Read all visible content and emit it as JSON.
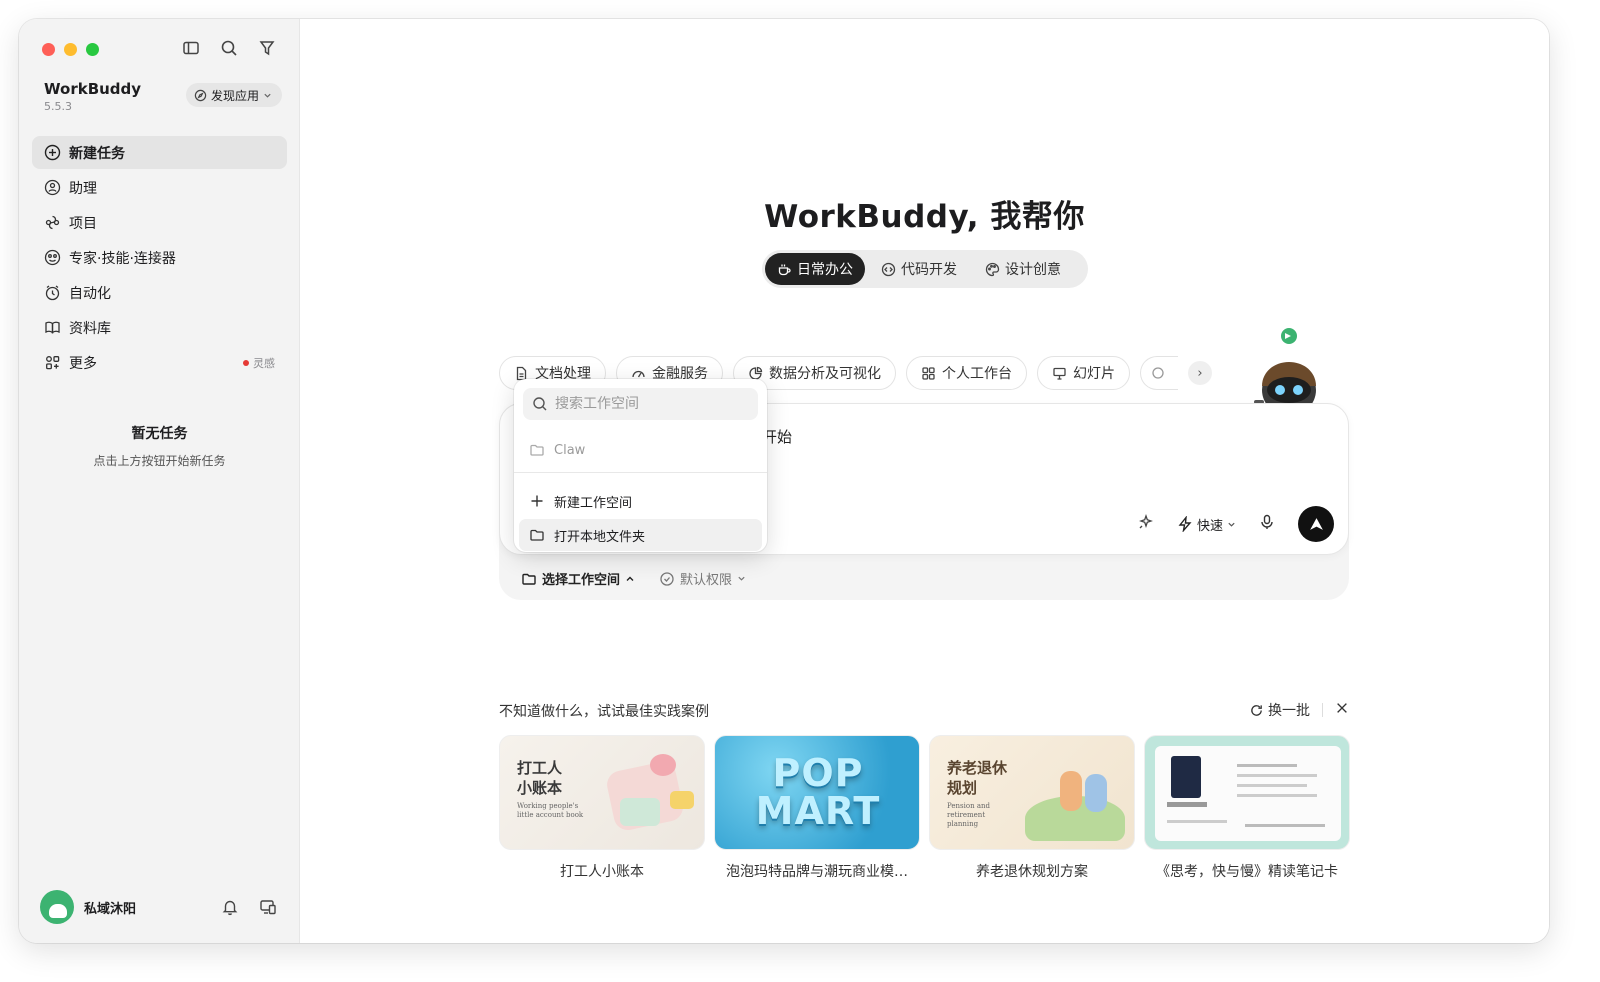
{
  "sidebar": {
    "app_name": "WorkBuddy",
    "version": "5.5.3",
    "discover_label": "发现应用",
    "items": [
      {
        "label": "新建任务",
        "icon": "plus-circle-icon"
      },
      {
        "label": "助理",
        "icon": "assistant-icon"
      },
      {
        "label": "项目",
        "icon": "project-icon"
      },
      {
        "label": "专家·技能·连接器",
        "icon": "expert-icon"
      },
      {
        "label": "自动化",
        "icon": "alarm-icon"
      },
      {
        "label": "资料库",
        "icon": "book-icon"
      },
      {
        "label": "更多",
        "icon": "grid-icon",
        "badge": "灵感"
      }
    ],
    "empty_title": "暂无任务",
    "empty_sub": "点击上方按钮开始新任务",
    "user_name": "私域沐阳"
  },
  "main": {
    "hero": "WorkBuddy, 我帮你",
    "tabs": [
      "日常办公",
      "代码开发",
      "设计创意"
    ],
    "chips": [
      "文档处理",
      "金融服务",
      "数据分析及可视化",
      "个人工作台",
      "幻灯片"
    ],
    "composer_text": "开始",
    "speed_label": "快速",
    "workspace_label": "选择工作空间",
    "permission_label": "默认权限",
    "dropdown": {
      "search_placeholder": "搜索工作空间",
      "recent": "Claw",
      "new_workspace": "新建工作空间",
      "open_folder": "打开本地文件夹"
    },
    "best_title": "不知道做什么，试试最佳实践案例",
    "refresh_label": "换一批",
    "cards": [
      {
        "label": "打工人小账本",
        "img_title_1": "打工人",
        "img_title_2": "小账本",
        "img_sub": "Working people's little account book"
      },
      {
        "label": "泡泡玛特品牌与潮玩商业模…",
        "img_title": "POP MART"
      },
      {
        "label": "养老退休规划方案",
        "img_title_1": "养老退休",
        "img_title_2": "规划",
        "img_sub": "Pension and retirement planning"
      },
      {
        "label": "《思考，快与慢》精读笔记卡"
      }
    ]
  }
}
